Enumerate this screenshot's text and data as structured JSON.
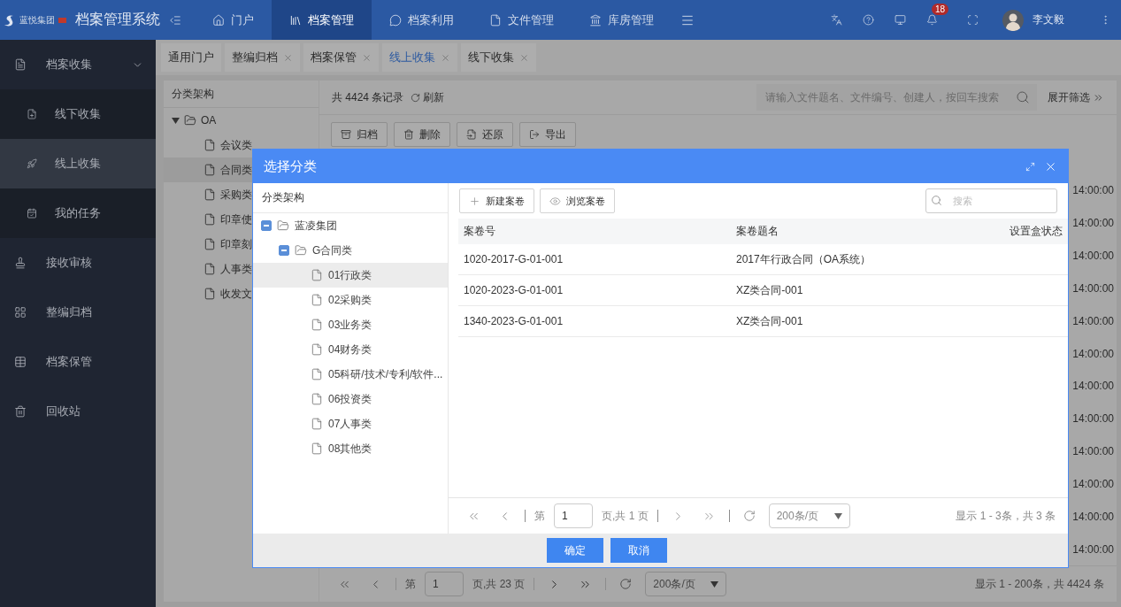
{
  "header": {
    "brand": "蓝悦集团",
    "title": "档案管理系统",
    "nav": [
      {
        "label": "门户",
        "selected": false
      },
      {
        "label": "档案管理",
        "selected": true
      },
      {
        "label": "档案利用",
        "selected": false
      },
      {
        "label": "文件管理",
        "selected": false
      },
      {
        "label": "库房管理",
        "selected": false
      }
    ],
    "notifications": "18",
    "user": "李文毅"
  },
  "sidebar": {
    "items": [
      {
        "label": "档案收集",
        "expanded": true,
        "selected": false,
        "children": [
          {
            "label": "线下收集",
            "selected": false
          },
          {
            "label": "线上收集",
            "selected": true
          },
          {
            "label": "我的任务",
            "selected": false
          }
        ]
      },
      {
        "label": "接收审核",
        "selected": false
      },
      {
        "label": "整编归档",
        "selected": false
      },
      {
        "label": "档案保管",
        "selected": false
      },
      {
        "label": "回收站",
        "selected": false
      }
    ]
  },
  "tabs": [
    {
      "label": "通用门户",
      "closable": false,
      "selected": false
    },
    {
      "label": "整编归档",
      "closable": true,
      "selected": false
    },
    {
      "label": "档案保管",
      "closable": true,
      "selected": false
    },
    {
      "label": "线上收集",
      "closable": true,
      "selected": true
    },
    {
      "label": "线下收集",
      "closable": true,
      "selected": false
    }
  ],
  "tree": {
    "title": "分类架构",
    "root": {
      "label": "OA",
      "expanded": true,
      "children": [
        {
          "label": "会议类",
          "selected": false
        },
        {
          "label": "合同类",
          "selected": true
        },
        {
          "label": "采购类",
          "selected": false
        },
        {
          "label": "印章使",
          "selected": false
        },
        {
          "label": "印章刻",
          "selected": false
        },
        {
          "label": "人事类",
          "selected": false
        },
        {
          "label": "收发文",
          "selected": false
        }
      ]
    }
  },
  "list": {
    "count": "共 4424 条记录",
    "refresh": "刷新",
    "search": {
      "placeholder": "请输入文件题名、文件编号、创建人，按回车搜索"
    },
    "filter": "展开筛选",
    "actions": [
      "归档",
      "删除",
      "还原",
      "导出"
    ],
    "times": [
      "14:00:00",
      "14:00:00",
      "14:00:00",
      "14:00:00",
      "14:00:00",
      "14:00:00",
      "14:00:00",
      "14:00:00",
      "14:00:00",
      "14:00:00",
      "14:00:00",
      "14:00:00"
    ],
    "pagination": {
      "before": "第",
      "page": "1",
      "after": "页,共 23 页",
      "page_size": "200条/页",
      "summary": "显示 1 - 200条，共 4424 条"
    }
  },
  "modal": {
    "title": "选择分类",
    "tree": {
      "title": "分类架构",
      "nodes": [
        {
          "label": "蓝凌集团",
          "expanded": true,
          "selected": false,
          "children": [
            {
              "label": "G合同类",
              "expanded": true,
              "selected": false,
              "children": [
                {
                  "label": "01行政类",
                  "selected": true
                },
                {
                  "label": "02采购类",
                  "selected": false
                },
                {
                  "label": "03业务类",
                  "selected": false
                },
                {
                  "label": "04财务类",
                  "selected": false
                },
                {
                  "label": "05科研/技术/专利/软件...",
                  "selected": false
                },
                {
                  "label": "06投资类",
                  "selected": false
                },
                {
                  "label": "07人事类",
                  "selected": false
                },
                {
                  "label": "08其他类",
                  "selected": false
                }
              ]
            }
          ]
        }
      ]
    },
    "actions": [
      "新建案卷",
      "浏览案卷"
    ],
    "search": {
      "placeholder": "搜索"
    },
    "table": {
      "columns": [
        "案卷号",
        "案卷题名",
        "设置盒状态"
      ],
      "rows": [
        [
          "1020-2017-G-01-001",
          "2017年行政合同（OA系统）"
        ],
        [
          "1020-2023-G-01-001",
          "XZ类合同-001"
        ],
        [
          "1340-2023-G-01-001",
          "XZ类合同-001"
        ]
      ]
    },
    "pagination": {
      "before": "第",
      "page": "1",
      "after": "页,共 1 页",
      "page_size": "200条/页",
      "summary": "显示 1 - 3条，共 3 条"
    },
    "buttons": [
      "确定",
      "取消"
    ]
  }
}
